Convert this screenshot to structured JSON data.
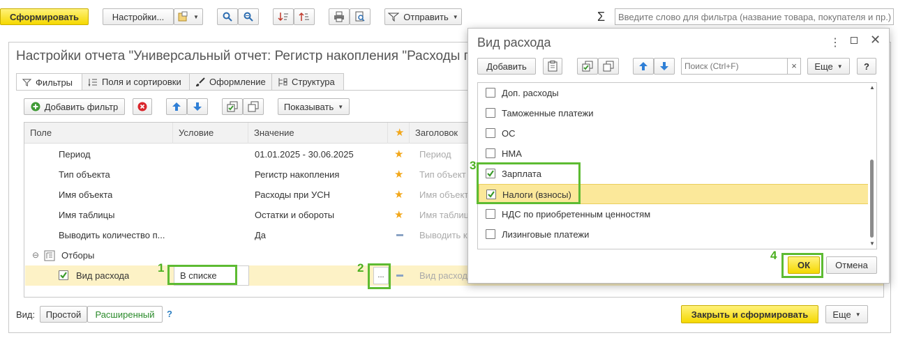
{
  "toolbar": {
    "form_label": "Сформировать",
    "settings_label": "Настройки...",
    "send_label": "Отправить",
    "sum_symbol": "Σ",
    "filter_placeholder": "Введите слово для фильтра (название товара, покупателя и пр.)"
  },
  "settings": {
    "title": "Настройки отчета \"Универсальный отчет: Регистр накопления \"Расходы пр",
    "tabs": [
      {
        "label": "Фильтры"
      },
      {
        "label": "Поля и сортировки"
      },
      {
        "label": "Оформление"
      },
      {
        "label": "Структура"
      }
    ],
    "add_filter": "Добавить фильтр",
    "show": "Показывать",
    "columns": {
      "field": "Поле",
      "condition": "Условие",
      "value": "Значение",
      "header": "Заголовок"
    },
    "rows": [
      {
        "field": "Период",
        "value": "01.01.2025 - 30.06.2025",
        "header": "Период"
      },
      {
        "field": "Тип объекта",
        "value": "Регистр накопления",
        "header": "Тип объект"
      },
      {
        "field": "Имя объекта",
        "value": "Расходы при УСН",
        "header": "Имя объект"
      },
      {
        "field": "Имя таблицы",
        "value": "Остатки и обороты",
        "header": "Имя таблиц"
      },
      {
        "field": "Выводить количество п...",
        "value": "Да",
        "header": "Выводить ко"
      }
    ],
    "group": "Отборы",
    "filter_row": {
      "field": "Вид расхода",
      "condition": "В списке",
      "ellipsis": "...",
      "header": "Вид расхода"
    },
    "view_label": "Вид:",
    "view_simple": "Простой",
    "view_extended": "Расширенный",
    "help": "?",
    "close_form": "Закрыть и сформировать",
    "more": "Еще"
  },
  "dialog": {
    "title": "Вид расхода",
    "add": "Добавить",
    "search_placeholder": "Поиск (Ctrl+F)",
    "clear": "×",
    "more": "Еще",
    "help": "?",
    "items": [
      {
        "label": "Доп. расходы",
        "checked": false
      },
      {
        "label": "Таможенные платежи",
        "checked": false
      },
      {
        "label": "ОС",
        "checked": false
      },
      {
        "label": "НМА",
        "checked": false
      },
      {
        "label": "Зарплата",
        "checked": true
      },
      {
        "label": "Налоги (взносы)",
        "checked": true
      },
      {
        "label": "НДС по приобретенным ценностям",
        "checked": false
      },
      {
        "label": "Лизинговые платежи",
        "checked": false
      }
    ],
    "ok": "ОК",
    "cancel": "Отмена"
  },
  "markers": {
    "m1": "1",
    "m2": "2",
    "m3": "3",
    "m4": "4"
  }
}
